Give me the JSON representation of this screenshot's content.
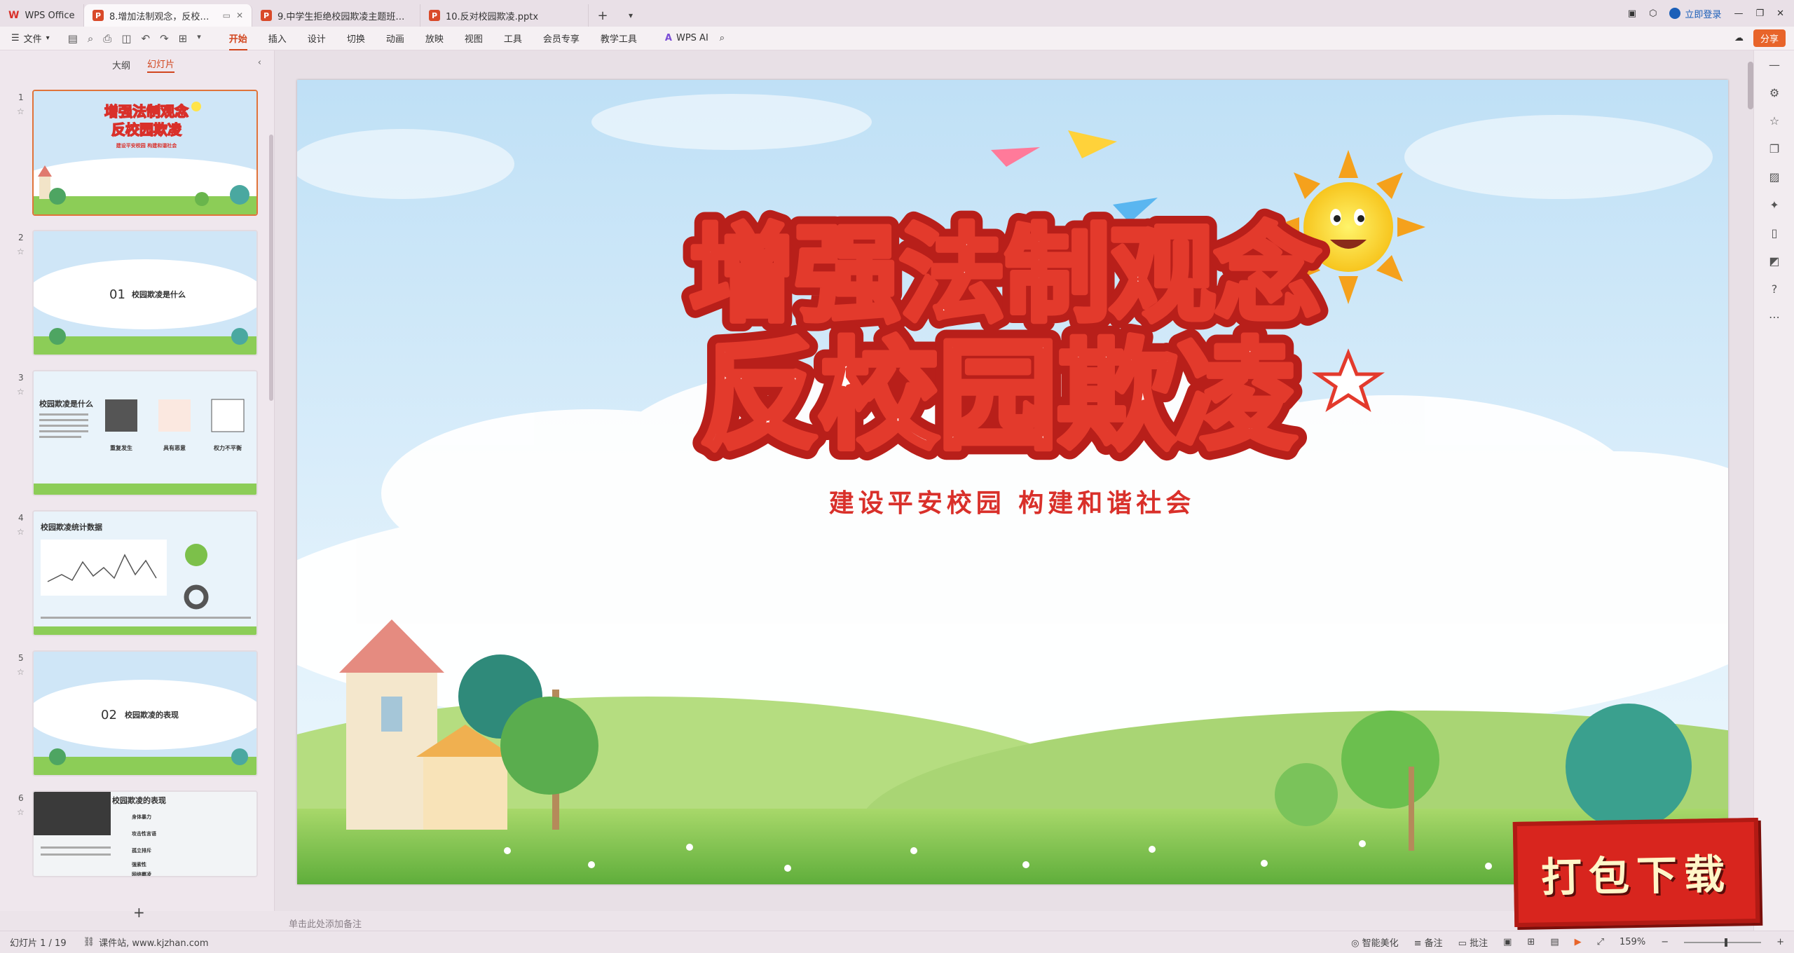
{
  "app": {
    "name": "WPS Office"
  },
  "tabs": [
    {
      "label": "8.增加法制观念，反校园欺凌...",
      "active": true
    },
    {
      "label": "9.中学生拒绝校园欺凌主题班会（精品..."
    },
    {
      "label": "10.反对校园欺凌.pptx"
    }
  ],
  "window": {
    "login_label": "立即登录"
  },
  "ribbon": {
    "file_label": "文件",
    "menus": [
      "开始",
      "插入",
      "设计",
      "切换",
      "动画",
      "放映",
      "视图",
      "工具",
      "会员专享",
      "教学工具"
    ],
    "active_menu": "开始",
    "ai_label": "WPS AI",
    "share_label": "分享"
  },
  "panel": {
    "outline_tab": "大纲",
    "slides_tab": "幻灯片",
    "thumbnails": [
      {
        "num": "1",
        "title": "增强法制观念 反校园欺凌",
        "sub": "建设平安校园  构建和谐社会"
      },
      {
        "num": "2",
        "section": "01",
        "title": "校园欺凌是什么"
      },
      {
        "num": "3",
        "title": "校园欺凌是什么",
        "labels": [
          "重复发生",
          "具有恶意",
          "权力不平衡"
        ]
      },
      {
        "num": "4",
        "title": "校园欺凌统计数据"
      },
      {
        "num": "5",
        "section": "02",
        "title": "校园欺凌的表现"
      },
      {
        "num": "6",
        "title": "校园欺凌的表现",
        "items": [
          "身体暴力",
          "攻击性言语",
          "孤立排斥",
          "强索性",
          "网络霸凌"
        ]
      }
    ]
  },
  "slide": {
    "title_line1": "增强法制观念",
    "title_line2": "反校园欺凌",
    "subtitle": "建设平安校园  构建和谐社会"
  },
  "notes_placeholder": "单击此处添加备注",
  "status": {
    "slide_counter": "幻灯片 1 / 19",
    "source": "课件站, www.kjzhan.com",
    "beautify": "智能美化",
    "notes": "备注",
    "comments": "批注",
    "zoom": "159%"
  },
  "promo": {
    "label": "打包下载"
  },
  "colors": {
    "accent": "#d1461f",
    "title_red": "#d9302a",
    "sky": "#cfe6f7",
    "grass": "#7cc04a"
  }
}
